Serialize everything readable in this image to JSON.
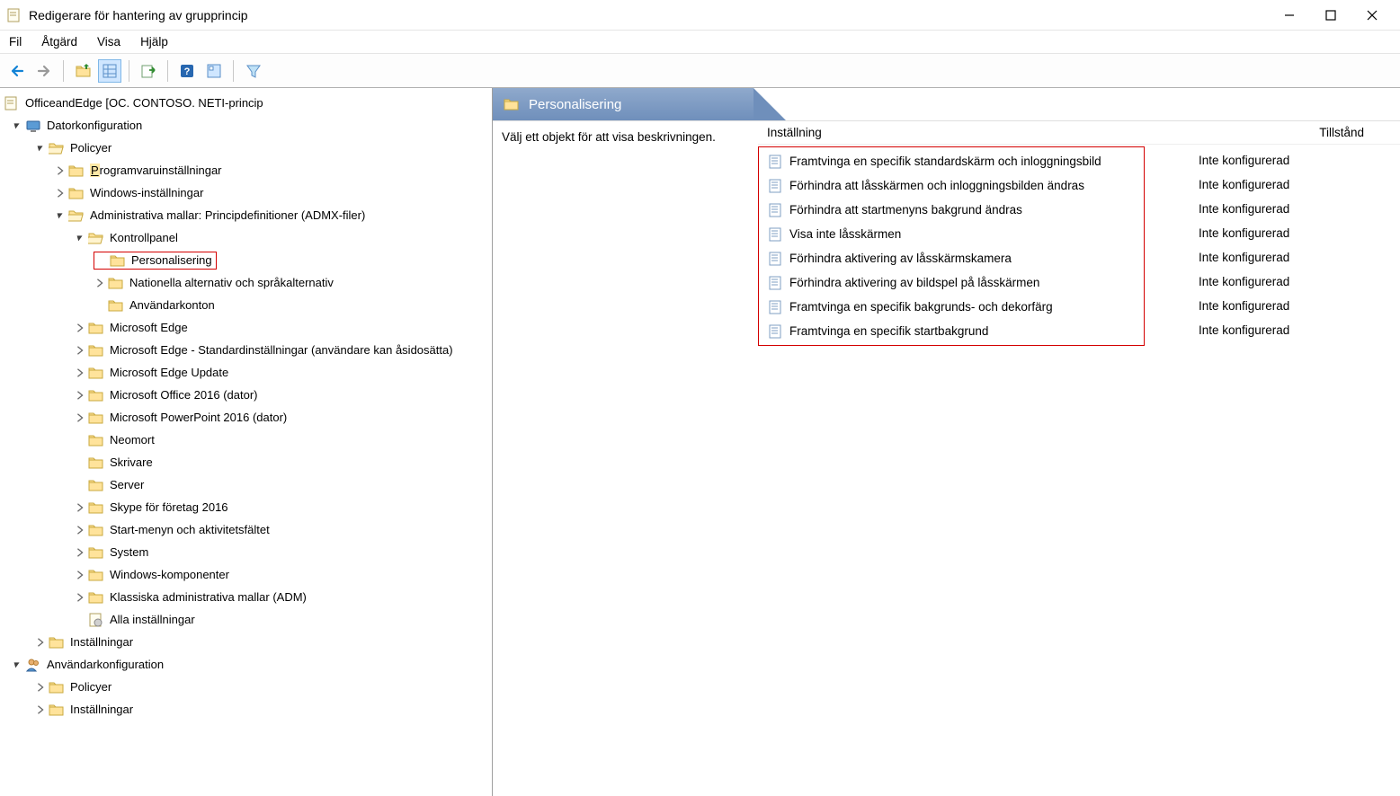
{
  "window": {
    "title": "Redigerare för hantering av grupprincip"
  },
  "menu": {
    "file": "Fil",
    "action": "Åtgärd",
    "view": "Visa",
    "help": "Hjälp"
  },
  "tree": {
    "root": "OfficeandEdge [OC. CONTOSO. NETI-princip",
    "computer_config": "Datorkonfiguration",
    "policies": "Policyer",
    "software_settings_p": "P",
    "software_settings_rest": "rogramvaruinställningar",
    "windows_settings": "Windows-inställningar",
    "admin_templates": "Administrativa mallar: Principdefinitioner (ADMX-filer)",
    "control_panel": "Kontrollpanel",
    "personalization": "Personalisering",
    "regional_lang": "Nationella alternativ och språkalternativ",
    "user_accounts": "Användarkonton",
    "edge": "Microsoft Edge",
    "edge_default": "Microsoft Edge - Standardinställningar (användare kan åsidosätta)",
    "edge_update": "Microsoft Edge Update",
    "office2016": "Microsoft Office 2016 (dator)",
    "powerpoint2016": "Microsoft PowerPoint 2016 (dator)",
    "neomort": "Neomort",
    "printers": "Skrivare",
    "server": "Server",
    "skype": "Skype för företag 2016",
    "start_taskbar": "Start-menyn och aktivitetsfältet",
    "system": "System",
    "windows_components": "Windows-komponenter",
    "classic_adm": "Klassiska administrativa mallar (ADM)",
    "all_settings": "Alla inställningar",
    "preferences": "Inställningar",
    "user_config": "Användarkonfiguration",
    "user_policies": "Policyer",
    "user_preferences": "Inställningar"
  },
  "details": {
    "header": "Personalisering",
    "select_hint": "Välj ett objekt för att visa beskrivningen.",
    "col_setting": "Inställning",
    "col_state": "Tillstånd",
    "state_not_configured": "Inte konfigurerad",
    "items": [
      "Framtvinga en specifik standardskärm och inloggningsbild",
      "Förhindra att låsskärmen och inloggningsbilden ändras",
      "Förhindra att startmenyns bakgrund ändras",
      "Visa inte låsskärmen",
      "Förhindra aktivering av låsskärmskamera",
      "Förhindra aktivering av bildspel på låsskärmen",
      "Framtvinga en specifik bakgrunds- och dekorfärg",
      "Framtvinga en specifik startbakgrund"
    ]
  }
}
